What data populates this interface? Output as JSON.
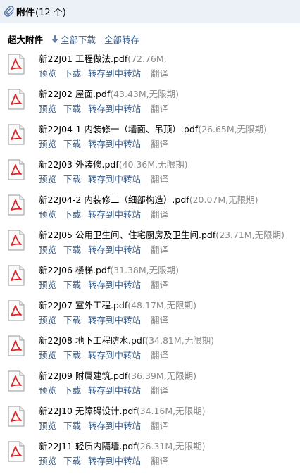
{
  "header": {
    "title": "附件",
    "count": "(12 个)"
  },
  "toolbar": {
    "label": "超大附件",
    "download_all": "全部下载",
    "forward_all": "全部转存"
  },
  "actions": {
    "preview": "预览",
    "download": "下载",
    "forward": "转存到中转站",
    "translate": "翻译"
  },
  "icons": {
    "header": "paperclip-icon",
    "download_all": "down-arrow-icon",
    "file": "pdf-file-icon"
  },
  "colors": {
    "header_bg": "#ecf1f8",
    "link": "#385d8a",
    "meta": "#8a8a8a",
    "pdf_red": "#d9272e"
  },
  "files": [
    {
      "name": "新22J01 工程做法.pdf",
      "meta": "(72.76M,"
    },
    {
      "name": "新22J02 屋面.pdf",
      "meta": "(43.43M,无限期)"
    },
    {
      "name": "新22J04-1 内装修一（墙面、吊顶）.pdf",
      "meta": "(26.65M,无限期)"
    },
    {
      "name": "新22J03 外装修.pdf",
      "meta": "(40.36M,无限期)"
    },
    {
      "name": "新22J04-2 内装修二（细部构造）.pdf",
      "meta": "(20.07M,无限期)"
    },
    {
      "name": "新22J05 公用卫生间、住宅厨房及卫生间.pdf",
      "meta": "(23.71M,无限期)"
    },
    {
      "name": "新22J06 楼梯.pdf",
      "meta": "(31.38M,无限期)"
    },
    {
      "name": "新22J07 室外工程.pdf",
      "meta": "(48.17M,无限期)"
    },
    {
      "name": "新22J08 地下工程防水.pdf",
      "meta": "(34.81M,无限期)"
    },
    {
      "name": "新22J09 附属建筑.pdf",
      "meta": "(36.39M,无限期)"
    },
    {
      "name": "新22J10 无障碍设计.pdf",
      "meta": "(34.16M,无限期)"
    },
    {
      "name": "新22J11 轻质内隔墙.pdf",
      "meta": "(26.31M,无限期)"
    }
  ]
}
